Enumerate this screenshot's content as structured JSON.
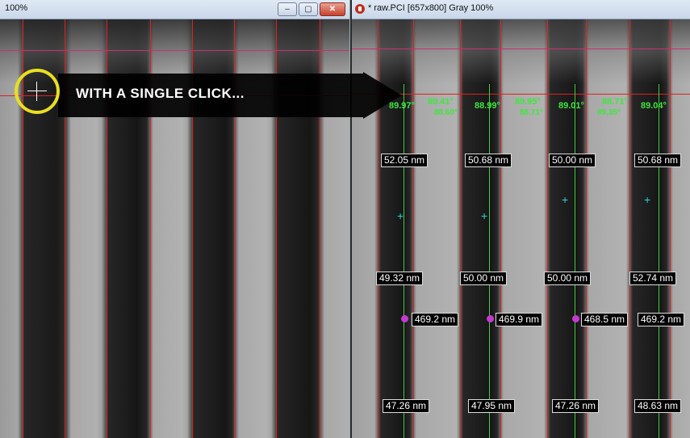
{
  "left_window": {
    "title": "100%",
    "controls": {
      "minimize": "‒",
      "maximize": "▢",
      "close": "✕"
    }
  },
  "right_window": {
    "title": "* raw.PCI [657x800] Gray 100%",
    "app_icon": "red-circle-app-icon",
    "angles": [
      {
        "top": "89.97°",
        "sub": ""
      },
      {
        "top": "89.41°",
        "sub": "88.60°"
      },
      {
        "top": "88.99°",
        "sub": ""
      },
      {
        "top": "89.95°",
        "sub": "88.71°"
      },
      {
        "top": "89.01°",
        "sub": ""
      },
      {
        "top": "88.71°",
        "sub": "89.35°"
      },
      {
        "top": "89.04°",
        "sub": ""
      }
    ],
    "widths_top": [
      "52.05 nm",
      "50.68 nm",
      "50.00 nm",
      "50.68 nm"
    ],
    "widths_mid": [
      "49.32 nm",
      "50.00 nm",
      "50.00 nm",
      "52.74 nm"
    ],
    "pitches": [
      "469.2 nm",
      "469.9 nm",
      "468.5 nm",
      "469.2 nm"
    ],
    "widths_bottom": [
      "47.26 nm",
      "47.95 nm",
      "47.26 nm",
      "48.63 nm"
    ]
  },
  "callout": {
    "text": "WITH A SINGLE CLICK..."
  },
  "colors": {
    "edge": "#e02020",
    "fit_line": "#3fcf3f",
    "angle_text": "#3ee63e",
    "callout_bg": "#000000",
    "highlight_ring": "#e8e020",
    "pitch_marker": "#c63ad0"
  }
}
